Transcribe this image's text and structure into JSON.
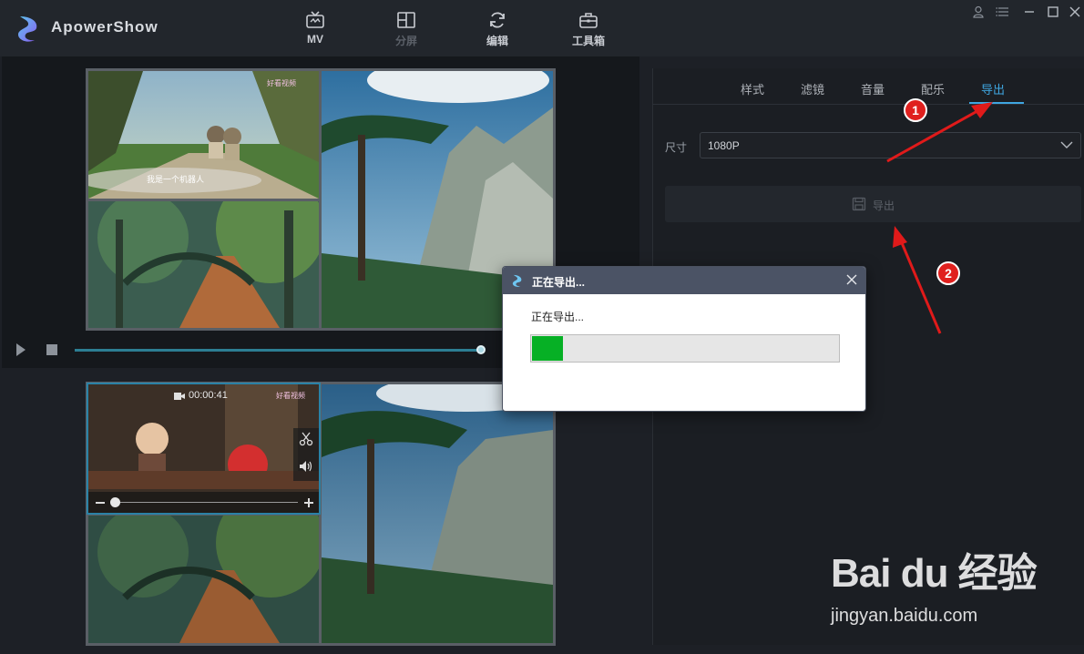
{
  "app": {
    "title": "ApowerShow"
  },
  "nav": [
    {
      "label": "MV",
      "icon": "tv-icon",
      "enabled": true
    },
    {
      "label": "分屏",
      "icon": "split-screen-icon",
      "enabled": false
    },
    {
      "label": "编辑",
      "icon": "refresh-icon",
      "enabled": true
    },
    {
      "label": "工具箱",
      "icon": "toolbox-icon",
      "enabled": true
    }
  ],
  "window_controls": [
    "user-icon",
    "menu-icon",
    "minimize-icon",
    "maximize-icon",
    "close-icon"
  ],
  "preview": {
    "watermark": "好看视频",
    "subtitle": "我是一个机器人"
  },
  "editor": {
    "clip_duration": "00:00:41",
    "watermark": "好看视频"
  },
  "panel": {
    "tabs": [
      "样式",
      "滤镜",
      "音量",
      "配乐",
      "导出"
    ],
    "active_tab": "导出",
    "size_label": "尺寸",
    "size_value": "1080P",
    "export_button": "导出"
  },
  "dialog": {
    "title": "正在导出...",
    "message": "正在导出...",
    "progress": 0.1
  },
  "annotations": {
    "markers": [
      "1",
      "2"
    ]
  },
  "baidu": {
    "logo_text": "Bai du 经验",
    "url": "jingyan.baidu.com"
  },
  "colors": {
    "accent": "#3fa6e0",
    "progress_green": "#06b025",
    "marker_red": "#e0201e"
  }
}
